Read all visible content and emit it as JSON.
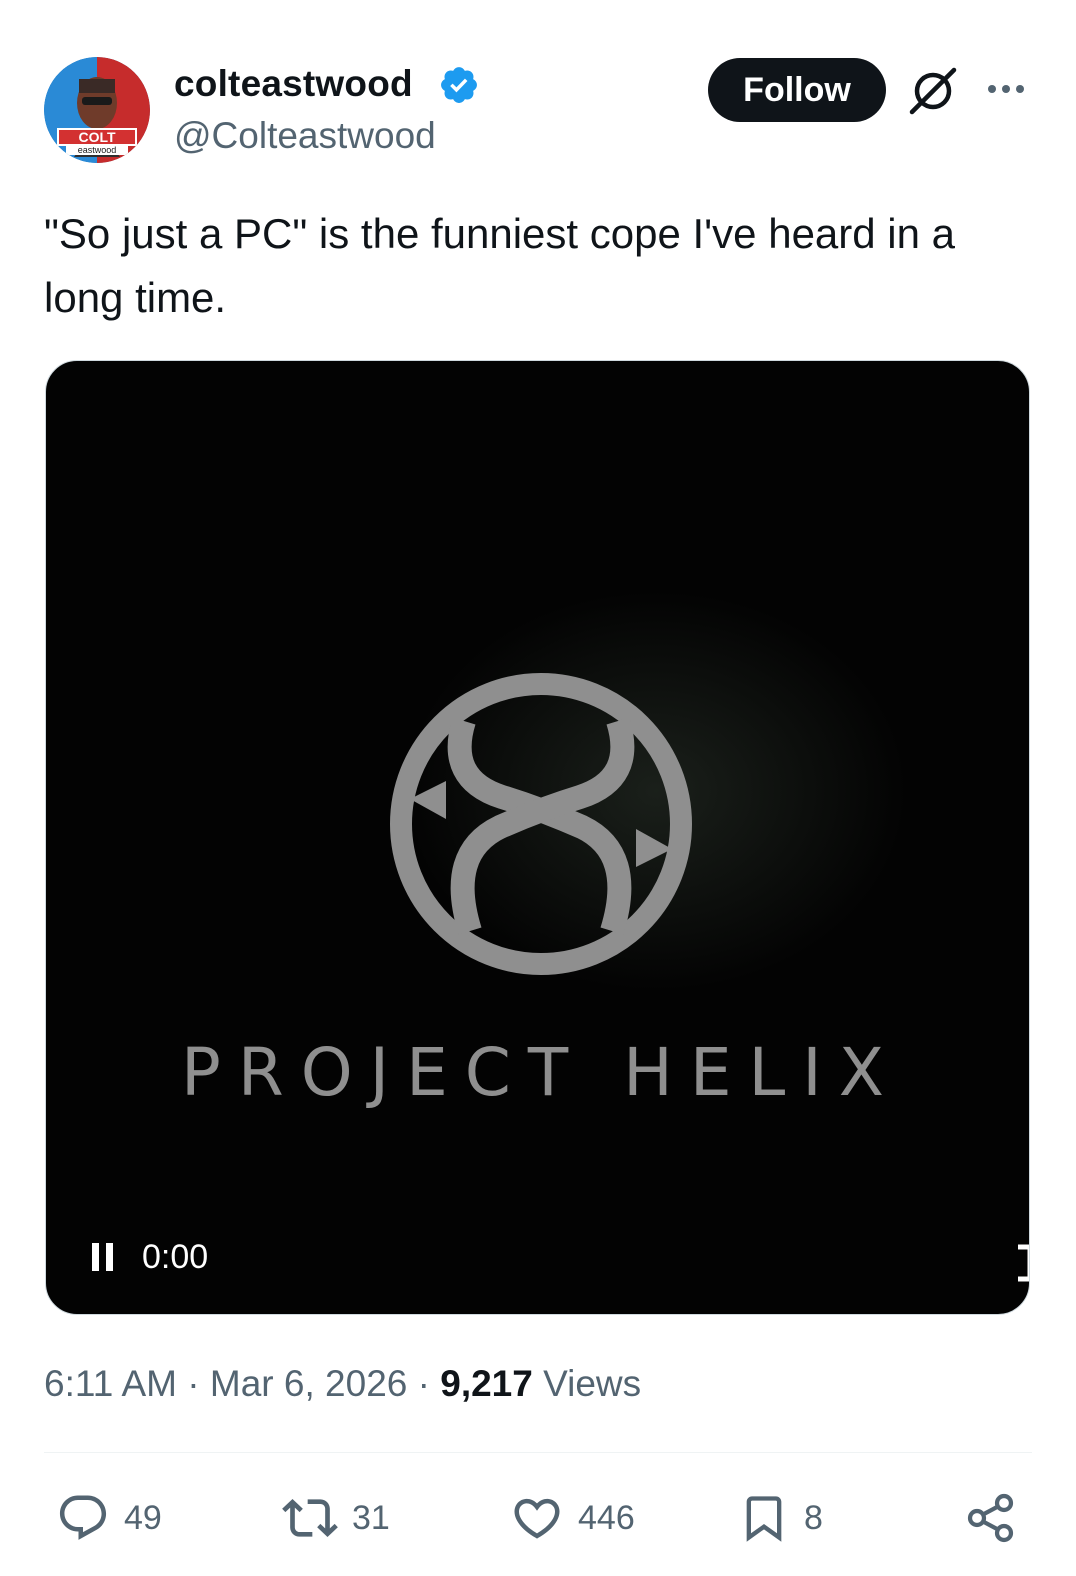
{
  "author": {
    "display_name": "colteastwood",
    "handle": "@Colteastwood",
    "avatar_text": [
      "COLT",
      "eastwood"
    ]
  },
  "header": {
    "follow_label": "Follow"
  },
  "tweet": {
    "text": "\"So just a PC\" is the funniest cope I've heard in a long time."
  },
  "media": {
    "wordmark": "PROJECT HELIX",
    "video_time": "0:00"
  },
  "meta": {
    "time": "6:11 AM",
    "sep1": "·",
    "date": "Mar 6, 2026",
    "sep2": "·",
    "views_count": "9,217",
    "views_label": "Views"
  },
  "actions": {
    "replies": "49",
    "reposts": "31",
    "likes": "446",
    "bookmarks": "8"
  },
  "colors": {
    "text_primary": "#0f1419",
    "text_secondary": "#536471",
    "verified_blue": "#1d9bf0",
    "media_bg": "#030303",
    "logo_gray": "#8f8f8f"
  },
  "icons": [
    "verified-badge-icon",
    "grok-icon",
    "more-icon",
    "pause-icon",
    "fullscreen-icon",
    "reply-icon",
    "repost-icon",
    "like-icon",
    "bookmark-icon",
    "share-icon"
  ]
}
